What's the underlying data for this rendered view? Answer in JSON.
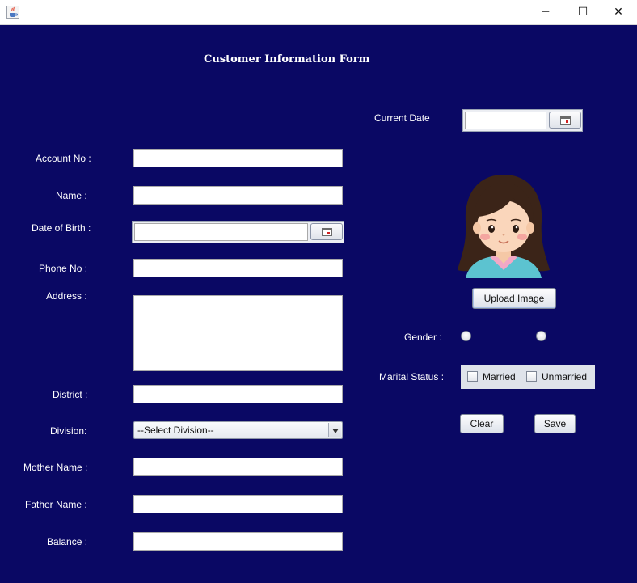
{
  "window": {
    "app_icon": "java-cup-icon",
    "controls": {
      "minimize": "─",
      "maximize": "☐",
      "close": "✕"
    }
  },
  "form": {
    "title": "Customer Information Form",
    "current_date_label": "Current Date",
    "account_no_label": "Account No :",
    "name_label": "Name :",
    "dob_label": "Date of Birth :",
    "phone_label": "Phone No :",
    "address_label": "Address :",
    "district_label": "District :",
    "division_label": "Division:",
    "division_value": "--Select Division--",
    "mother_label": "Mother Name :",
    "father_label": "Father Name :",
    "balance_label": "Balance :",
    "upload_label": "Upload Image",
    "gender_label": "Gender :",
    "marital_label": "Marital Status :",
    "married_label": "Married",
    "unmarried_label": "Unmarried",
    "clear_label": "Clear",
    "save_label": "Save"
  },
  "colors": {
    "background": "#0a0864",
    "label_text": "#ffffff"
  }
}
